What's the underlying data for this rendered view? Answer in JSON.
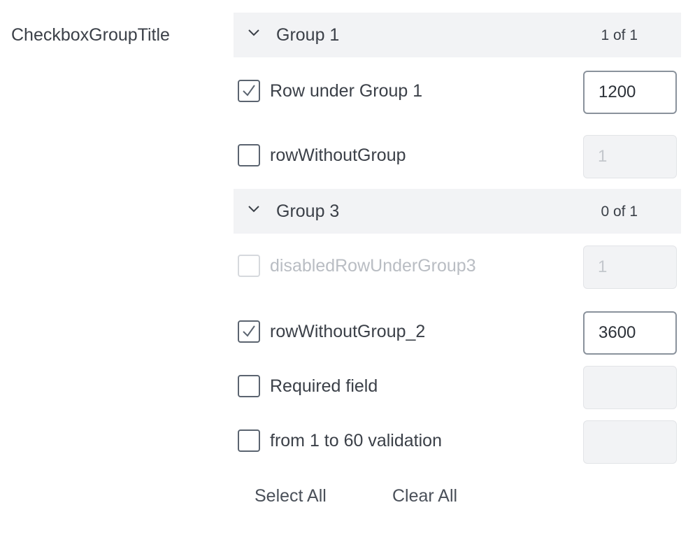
{
  "title": "CheckboxGroupTitle",
  "groups": [
    {
      "label": "Group 1",
      "count": "1 of 1"
    },
    {
      "label": "Group 3",
      "count": "0 of 1"
    }
  ],
  "rows": [
    {
      "label": "Row under Group 1",
      "checked": true,
      "value": "1200",
      "disabled": false
    },
    {
      "label": "rowWithoutGroup",
      "checked": false,
      "value": "1",
      "disabled": false
    },
    {
      "label": "disabledRowUnderGroup3",
      "checked": false,
      "value": "1",
      "disabled": true
    },
    {
      "label": "rowWithoutGroup_2",
      "checked": true,
      "value": "3600",
      "disabled": false
    },
    {
      "label": "Required field",
      "checked": false,
      "value": "",
      "disabled": false
    },
    {
      "label": "from 1 to 60 validation",
      "checked": false,
      "value": "",
      "disabled": false
    }
  ],
  "actions": {
    "select_all": "Select All",
    "clear_all": "Clear All"
  }
}
